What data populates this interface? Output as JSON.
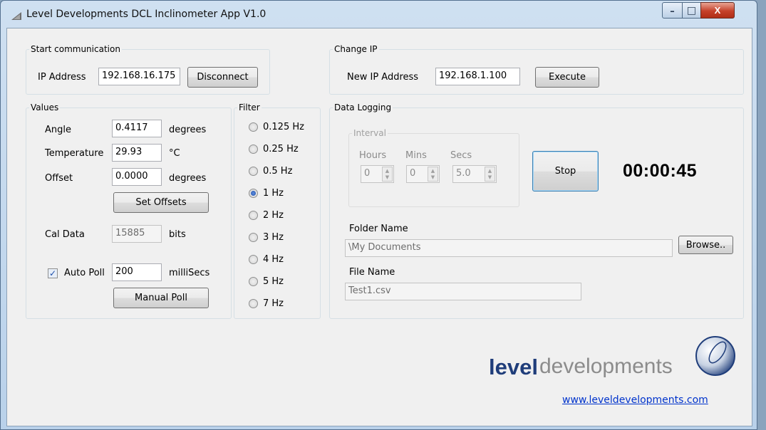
{
  "window": {
    "title": "Level Developments DCL Inclinometer App V1.0"
  },
  "controls": {
    "minimize": "–",
    "maximize": "□",
    "close": "X"
  },
  "communication": {
    "legend": "Start communication",
    "ip_label": "IP Address",
    "ip_value": "192.168.16.175",
    "disconnect_label": "Disconnect"
  },
  "change_ip": {
    "legend": "Change IP",
    "new_ip_label": "New IP Address",
    "new_ip_value": "192.168.1.100",
    "execute_label": "Execute"
  },
  "values": {
    "legend": "Values",
    "angle_label": "Angle",
    "angle_value": "0.4117",
    "angle_unit": "degrees",
    "temp_label": "Temperature",
    "temp_value": "29.93",
    "temp_unit": "°C",
    "offset_label": "Offset",
    "offset_value": "0.0000",
    "offset_unit": "degrees",
    "set_offsets_label": "Set Offsets",
    "cal_label": "Cal Data",
    "cal_value": "15885",
    "cal_unit": "bits",
    "autopoll_label": "Auto Poll",
    "autopoll_checked": true,
    "autopoll_value": "200",
    "autopoll_unit": "milliSecs",
    "manual_poll_label": "Manual Poll"
  },
  "filter": {
    "legend": "Filter",
    "options": [
      "0.125 Hz",
      "0.25 Hz",
      "0.5 Hz",
      "1 Hz",
      "2 Hz",
      "3 Hz",
      "4 Hz",
      "5 Hz",
      "7 Hz"
    ],
    "selected": "1 Hz"
  },
  "logging": {
    "legend": "Data Logging",
    "interval_legend": "Interval",
    "hours_label": "Hours",
    "hours_value": "0",
    "mins_label": "Mins",
    "mins_value": "0",
    "secs_label": "Secs",
    "secs_value": "5.0",
    "stop_label": "Stop",
    "elapsed": "00:00:45",
    "folder_label": "Folder Name",
    "folder_value": "\\My Documents",
    "browse_label": "Browse..",
    "file_label": "File Name",
    "file_value": "Test1.csv"
  },
  "branding": {
    "logo_bold": "level",
    "logo_light": "developments",
    "url": "www.leveldevelopments.com",
    "logo_blue": "#1f3d7a",
    "logo_grey": "#8c8c8c"
  }
}
